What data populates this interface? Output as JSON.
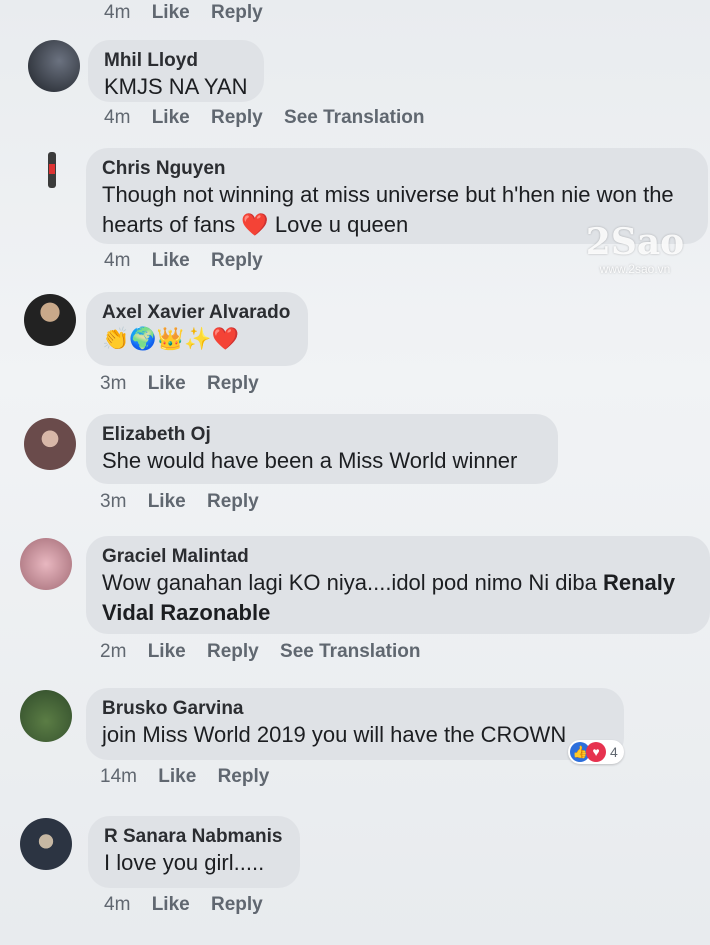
{
  "actions": {
    "like": "Like",
    "reply": "Reply",
    "see_translation": "See Translation"
  },
  "watermark": {
    "logo": "2Sao",
    "url": "www.2sao.vn"
  },
  "top_row": {
    "time": "4m"
  },
  "comments": [
    {
      "name": "Mhil Lloyd",
      "text": "KMJS NA YAN",
      "time": "4m",
      "translation": true
    },
    {
      "name": "Chris Nguyen",
      "text": "Though not winning at miss universe but h'hen nie won the hearts of fans ❤️ Love u queen",
      "time": "4m"
    },
    {
      "name": "Axel Xavier Alvarado",
      "text": "👏🌍👑✨❤️",
      "time": "3m"
    },
    {
      "name": "Elizabeth Oj",
      "text": "She would have been a Miss World winner",
      "time": "3m"
    },
    {
      "name": "Graciel Malintad",
      "text": "Wow ganahan lagi KO niya....idol pod nimo Ni diba ",
      "mention": "Renaly Vidal Razonable",
      "time": "2m",
      "translation": true
    },
    {
      "name": "Brusko Garvina",
      "text": "join Miss World 2019 you will have the CROWN",
      "time": "14m",
      "reaction_count": "4"
    },
    {
      "name": "R Sanara Nabmanis",
      "text": "I love you girl.....",
      "time": "4m"
    }
  ]
}
